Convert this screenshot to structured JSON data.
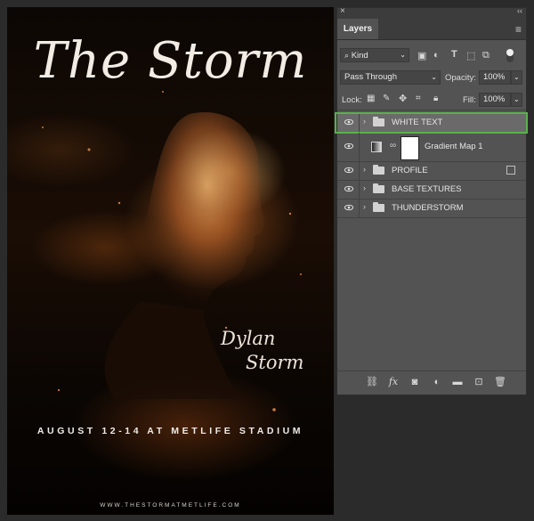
{
  "poster": {
    "title": "The Storm",
    "artist_first": "Dylan",
    "artist_last": "Storm",
    "date_line": "AUGUST 12-14 AT METLIFE STADIUM",
    "url": "WWW.THESTORMATMETLIFE.COM"
  },
  "panel": {
    "close_glyph": "×",
    "collapse_glyph": "‹‹",
    "tab_label": "Layers",
    "menu_glyph": "≡",
    "filter": {
      "value": "Kind",
      "icon": "search-icon"
    },
    "blend": {
      "mode": "Pass Through",
      "opacity_label": "Opacity:",
      "opacity_value": "100%"
    },
    "lock": {
      "label": "Lock:",
      "fill_label": "Fill:",
      "fill_value": "100%"
    },
    "layers": [
      {
        "name": "WHITE TEXT",
        "type": "group",
        "selected": true
      },
      {
        "name": "Gradient Map 1",
        "type": "adjustment"
      },
      {
        "name": "PROFILE",
        "type": "group",
        "clipping": true
      },
      {
        "name": "BASE TEXTURES",
        "type": "group"
      },
      {
        "name": "THUNDERSTORM",
        "type": "group"
      }
    ],
    "footer_icons": [
      "link-icon",
      "fx-icon",
      "mask-icon",
      "adjustment-icon",
      "folder-icon",
      "new-layer-icon",
      "trash-icon"
    ],
    "fx_label": "fx"
  },
  "colors": {
    "highlight": "#59b14c",
    "panel_bg": "#535353",
    "app_bg": "#2b2b2b"
  }
}
